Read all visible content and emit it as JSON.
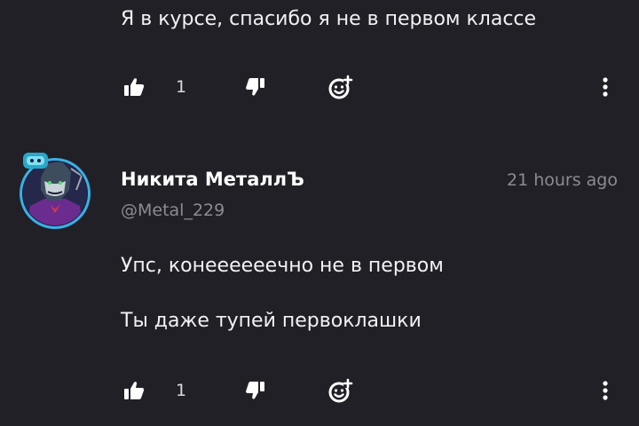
{
  "previous_comment": {
    "text": "Я в курсе, спасибо я не в первом классе",
    "actions": {
      "like_icon": "thumbs-up-icon",
      "like_count": "1",
      "dislike_icon": "thumbs-down-icon",
      "reaction_icon": "add-emoji-icon",
      "more_icon": "more-vertical-icon"
    }
  },
  "comment": {
    "author": {
      "name": "Никита МеталлЪ",
      "handle": "@Metal_229",
      "avatar_icon": "user-avatar",
      "avatar_ring_color": "#3ab0e6"
    },
    "timestamp": "21 hours ago",
    "lines": [
      "Упс, конеееееечно не в первом",
      "Ты даже тупей первоклашки"
    ],
    "actions": {
      "like_icon": "thumbs-up-icon",
      "like_count": "1",
      "dislike_icon": "thumbs-down-icon",
      "reaction_icon": "add-emoji-icon",
      "more_icon": "more-vertical-icon"
    }
  },
  "colors": {
    "background": "#212027",
    "text": "#f2f2f4",
    "muted_text": "#8c8b93",
    "icon": "#ffffff"
  }
}
